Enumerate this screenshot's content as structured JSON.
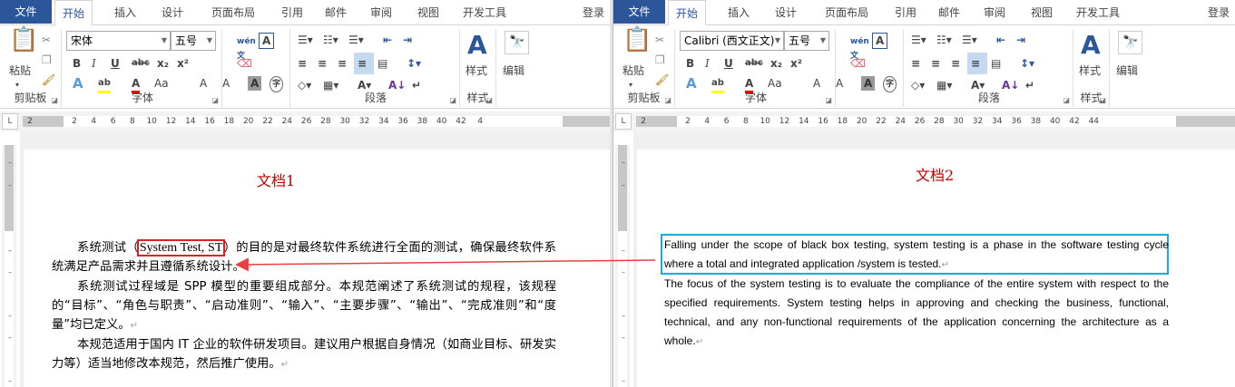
{
  "windows": [
    {
      "tabs": {
        "file": "文件",
        "items": [
          "开始",
          "插入",
          "设计",
          "页面布局",
          "引用",
          "邮件",
          "审阅",
          "视图",
          "开发工具"
        ],
        "active": "开始",
        "login": "登录"
      },
      "ribbon": {
        "clipboard": {
          "paste": "粘贴",
          "label": "剪贴板"
        },
        "font": {
          "name": "宋体",
          "size": "五号",
          "label": "字体"
        },
        "paragraph": {
          "label": "段落"
        },
        "styles": {
          "button": "样式",
          "label": "样式"
        },
        "editing": {
          "button": "编辑"
        }
      },
      "ruler": [
        "2",
        "2",
        "4",
        "6",
        "8",
        "10",
        "12",
        "14",
        "16",
        "18",
        "20",
        "22",
        "24",
        "26",
        "28",
        "30",
        "32",
        "34",
        "36",
        "38",
        "40",
        "42",
        "4"
      ]
    },
    {
      "tabs": {
        "file": "文件",
        "items": [
          "开始",
          "插入",
          "设计",
          "页面布局",
          "引用",
          "邮件",
          "审阅",
          "视图",
          "开发工具"
        ],
        "active": "开始",
        "login": "登录"
      },
      "ribbon": {
        "clipboard": {
          "paste": "粘贴",
          "label": "剪贴板"
        },
        "font": {
          "name": "Calibri (西文正文)",
          "size": "五号",
          "label": "字体"
        },
        "paragraph": {
          "label": "段落"
        },
        "styles": {
          "button": "样式",
          "label": "样式"
        },
        "editing": {
          "button": "编辑"
        }
      },
      "ruler": [
        "2",
        "2",
        "4",
        "6",
        "8",
        "10",
        "12",
        "14",
        "16",
        "18",
        "20",
        "22",
        "24",
        "26",
        "28",
        "30",
        "32",
        "34",
        "36",
        "38",
        "40",
        "42",
        "44"
      ]
    }
  ],
  "doc1": {
    "title": "文档1",
    "p1_pre": "系统测试（",
    "p1_highlight": "System Test, ST",
    "p1_post": "）的目的是对最终软件系统进行全面的测试，确保最终软件系统满足产品需求并且遵循系统设计。",
    "p2": "系统测试过程域是 SPP 模型的重要组成部分。本规范阐述了系统测试的规程，该规程的“目标”、“角色与职责”、“启动准则”、“输入”、“主要步骤”、“输出”、“完成准则”和“度量”均已定义。",
    "p3": "本规范适用于国内 IT 企业的软件研发项目。建议用户根据自身情况（如商业目标、研发实力等）适当地修改本规范，然后推广使用。"
  },
  "doc2": {
    "title": "文档2",
    "p1": "Falling under the scope of black box testing, system testing is a phase in the software testing cycle where a total and integrated application /system is tested.",
    "p2": "The focus of the system testing is to evaluate the compliance of the entire system with respect to the specified requirements. System testing helps in approving and checking the business, functional, technical, and any non-functional requirements of the application concerning the architecture as a whole."
  },
  "paragraph_mark": "↵",
  "colors": {
    "file_tab": "#2b579a",
    "title": "#c00000",
    "highlight_box": "#e02020",
    "source_box": "#1fa8e0",
    "arrow": "#e84040"
  }
}
